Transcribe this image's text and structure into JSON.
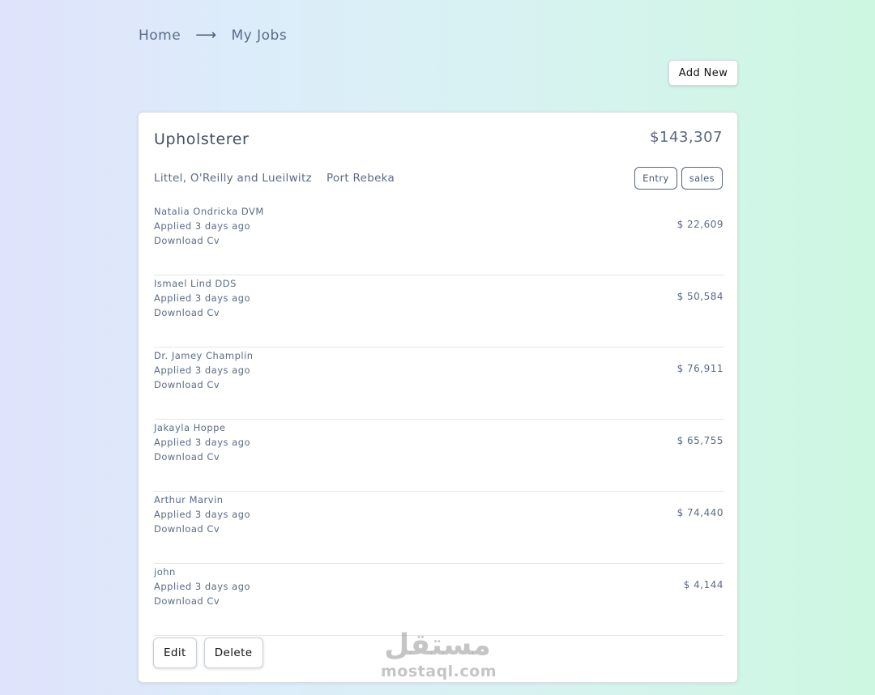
{
  "breadcrumb": {
    "home": "Home",
    "separator": "⟶",
    "current": "My Jobs"
  },
  "add_new_label": "Add New",
  "job": {
    "title": "Upholsterer",
    "salary": "$143,307",
    "company": "Littel, O'Reilly and Lueilwitz",
    "location": "Port Rebeka",
    "tags": [
      "Entry",
      "sales"
    ]
  },
  "applicants": [
    {
      "name": "Natalia Ondricka DVM",
      "applied": "Applied 3 days ago",
      "download": "Download Cv",
      "amount": "$ 22,609"
    },
    {
      "name": "Ismael Lind DDS",
      "applied": "Applied 3 days ago",
      "download": "Download Cv",
      "amount": "$ 50,584"
    },
    {
      "name": "Dr. Jamey Champlin",
      "applied": "Applied 3 days ago",
      "download": "Download Cv",
      "amount": "$ 76,911"
    },
    {
      "name": "Jakayla Hoppe",
      "applied": "Applied 3 days ago",
      "download": "Download Cv",
      "amount": "$ 65,755"
    },
    {
      "name": "Arthur Marvin",
      "applied": "Applied 3 days ago",
      "download": "Download Cv",
      "amount": "$ 74,440"
    },
    {
      "name": "john",
      "applied": "Applied 3 days ago",
      "download": "Download Cv",
      "amount": "$ 4,144"
    }
  ],
  "actions": {
    "edit": "Edit",
    "delete": "Delete"
  },
  "watermark": {
    "arabic": "مستقل",
    "latin": "mostaql.com"
  }
}
